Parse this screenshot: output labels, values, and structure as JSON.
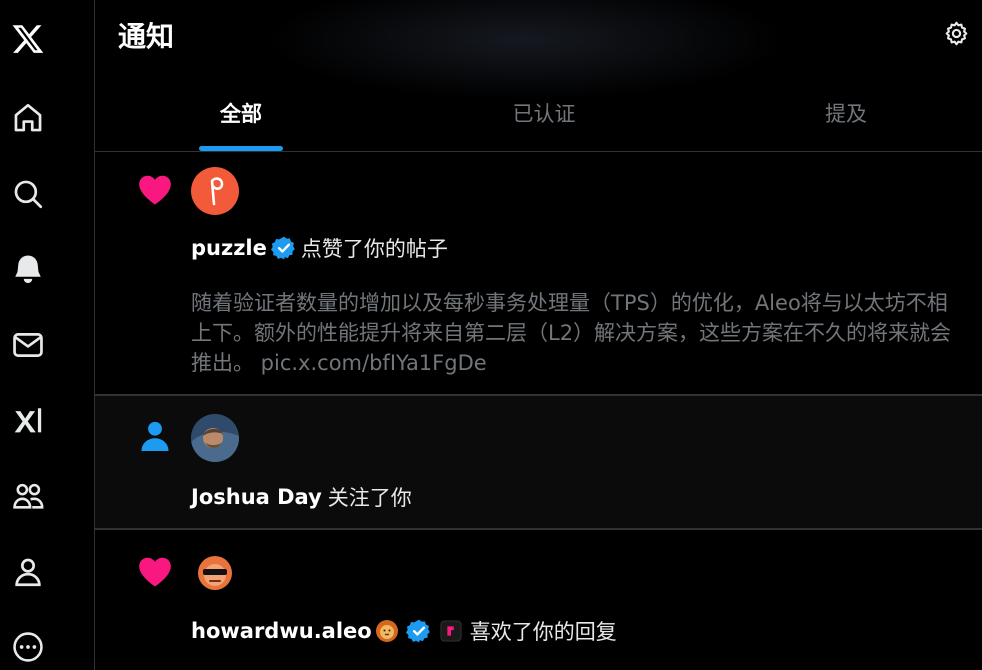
{
  "header": {
    "title": "通知",
    "tabs": [
      {
        "label": "全部",
        "active": true
      },
      {
        "label": "已认证",
        "active": false
      },
      {
        "label": "提及",
        "active": false
      }
    ]
  },
  "sidebar": {
    "icons": [
      "x-logo-icon",
      "home-icon",
      "search-icon",
      "notifications-icon",
      "messages-icon",
      "grok-icon",
      "communities-icon",
      "profile-icon",
      "more-icon"
    ]
  },
  "notifications": [
    {
      "type": "like",
      "user": "puzzle",
      "verified": true,
      "action": "点赞了你的帖子",
      "excerpt": "随着验证者数量的增加以及每秒事务处理量（TPS）的优化，Aleo将与以太坊不相上下。额外的性能提升将来自第二层（L2）解决方案，这些方案在不久的将来就会推出。 pic.x.com/bfIYa1FgDe"
    },
    {
      "type": "follow",
      "user": "Joshua Day",
      "verified": false,
      "action": "关注了你"
    },
    {
      "type": "like",
      "user": "howardwu.aleo",
      "verified": true,
      "action": "喜欢了你的回复"
    }
  ],
  "colors": {
    "accent": "#1d9bf0",
    "like": "#f91880",
    "background": "#000000",
    "muted": "#71767b"
  }
}
